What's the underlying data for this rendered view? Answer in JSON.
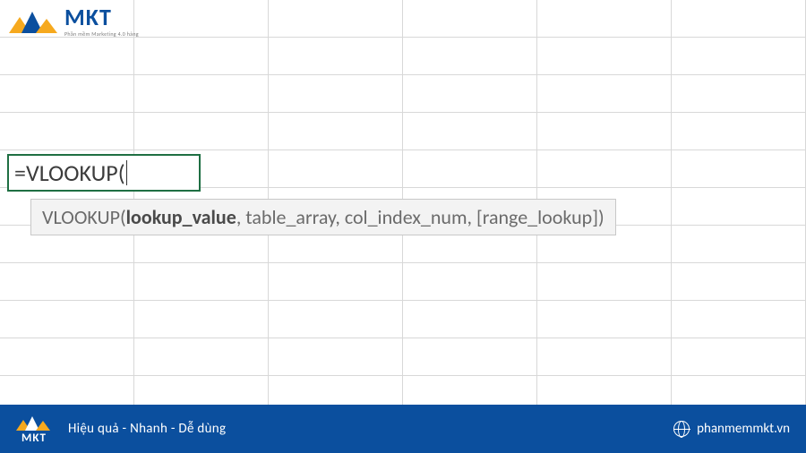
{
  "brand": {
    "name": "MKT",
    "subline": "Phần mềm Marketing 4.0 hàng"
  },
  "sheet": {
    "active_cell_value": "=VLOOKUP(",
    "tooltip": {
      "fn": "VLOOKUP",
      "current_arg": "lookup_value",
      "rest": ", table_array, col_index_num, [range_lookup])"
    }
  },
  "footer": {
    "brand": "MKT",
    "tagline": "Hiệu quả - Nhanh  - Dễ dùng",
    "site": "phanmemmkt.vn"
  }
}
